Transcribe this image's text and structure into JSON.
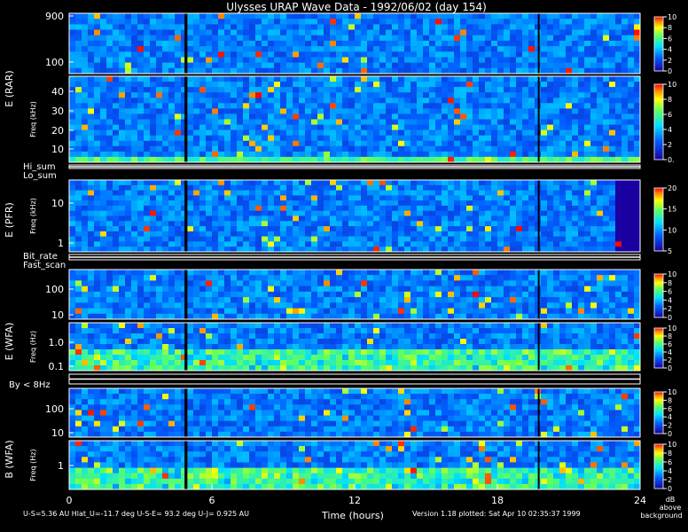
{
  "chart_data": {
    "type": "heatmap",
    "title": "Ulysses URAP Wave Data - 1992/06/02  (day 154)",
    "xlabel": "Time (hours)",
    "xlim": [
      0,
      24
    ],
    "xticks": [
      "0",
      "6",
      "12",
      "18",
      "24"
    ],
    "panels": [
      {
        "id": "rar1",
        "instrument": "E (RAR)",
        "ylabel": "",
        "yticks": [
          "900",
          "100"
        ],
        "scale": "log",
        "ylim": [
          50,
          1000
        ],
        "cbar_ticks": [
          "10",
          "8",
          "6",
          "4",
          "2",
          "0"
        ],
        "cbar_range": [
          0,
          10
        ]
      },
      {
        "id": "rar2",
        "instrument": "",
        "ylabel": "Freq (kHz)",
        "yticks": [
          "40",
          "30",
          "20",
          "10"
        ],
        "scale": "linear",
        "ylim": [
          0,
          48
        ],
        "cbar_ticks": [
          "10",
          "8",
          "6",
          "4",
          "2",
          "0."
        ],
        "cbar_range": [
          0,
          10
        ]
      },
      {
        "id": "pfr",
        "instrument": "E (PFR)",
        "ylabel": "Freq (kHz)",
        "yticks": [
          "10",
          "1"
        ],
        "scale": "log",
        "ylim": [
          0.5,
          30
        ],
        "cbar_ticks": [
          "20",
          "15",
          "10",
          "5"
        ],
        "cbar_range": [
          0,
          20
        ]
      },
      {
        "id": "wfa1",
        "instrument": "E (WFA)",
        "ylabel": "",
        "yticks": [
          "100",
          "10"
        ],
        "scale": "log",
        "ylim": [
          8,
          500
        ],
        "cbar_ticks": [
          "10",
          "8",
          "6",
          "4",
          "2",
          "0"
        ],
        "cbar_range": [
          0,
          10
        ]
      },
      {
        "id": "wfa2",
        "instrument": "",
        "ylabel": "Freq (Hz)",
        "yticks": [
          "1.0",
          "0.1"
        ],
        "scale": "log",
        "ylim": [
          0.08,
          5
        ],
        "cbar_ticks": [
          "10",
          "8",
          "6",
          "4",
          "2",
          "0"
        ],
        "cbar_range": [
          0,
          10
        ]
      },
      {
        "id": "wfa3",
        "instrument": "",
        "ylabel": "",
        "yticks": [
          "100",
          "10"
        ],
        "scale": "log",
        "ylim": [
          8,
          500
        ],
        "cbar_ticks": [
          "10",
          "8",
          "6",
          "4",
          "2",
          "0"
        ],
        "cbar_range": [
          0,
          10
        ]
      },
      {
        "id": "wfa4",
        "instrument": "B (WFA)",
        "ylabel": "Freq (Hz)",
        "yticks": [
          "1"
        ],
        "scale": "log",
        "ylim": [
          0.08,
          5
        ],
        "cbar_ticks": [
          "10",
          "8",
          "6",
          "4",
          "2",
          "0"
        ],
        "cbar_range": [
          0,
          10
        ]
      }
    ],
    "strip_labels": [
      "Hi_sum",
      "Lo_sum",
      "Bit_rate",
      "Fast_scan",
      "By < 8Hz"
    ],
    "colorbar_unit": [
      "dB",
      "above",
      "background"
    ],
    "colors": {
      "low": "#00009a",
      "mid": "#00c8ff",
      "high": "#ffff00",
      "max": "#ff2a00"
    }
  },
  "footer": {
    "ephemeris": "U-S=5.36 AU  Hlat_U=-11.7 deg  U-S-E= 93.2 deg  U-J= 0.925 AU",
    "version": "Version 1.18 plotted: Sat Apr 10 02:35:37 1999"
  }
}
